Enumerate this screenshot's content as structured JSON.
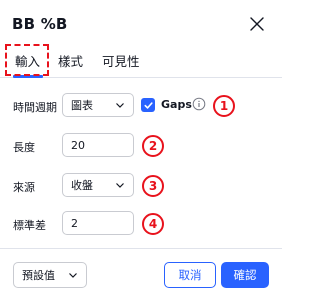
{
  "dialog": {
    "title": "BB %B"
  },
  "tabs": [
    {
      "label": "輸入",
      "active": true
    },
    {
      "label": "樣式"
    },
    {
      "label": "可見性"
    }
  ],
  "inputs": {
    "timeframe": {
      "label": "時間週期",
      "value": "圖表"
    },
    "gaps": {
      "label": "Gaps",
      "checked": true
    },
    "length": {
      "label": "長度",
      "value": "20"
    },
    "source": {
      "label": "來源",
      "value": "收盤"
    },
    "stddev": {
      "label": "標準差",
      "value": "2"
    }
  },
  "markers": [
    "1",
    "2",
    "3",
    "4"
  ],
  "footer": {
    "defaults": "預設值",
    "cancel": "取消",
    "ok": "確認"
  },
  "colors": {
    "accent": "#2962ff",
    "annotation": "#e8121c",
    "border": "#c9cbd1",
    "text": "#131722"
  },
  "icons": [
    "close-icon",
    "chevron-down-icon",
    "checkmark-icon",
    "info-icon"
  ]
}
